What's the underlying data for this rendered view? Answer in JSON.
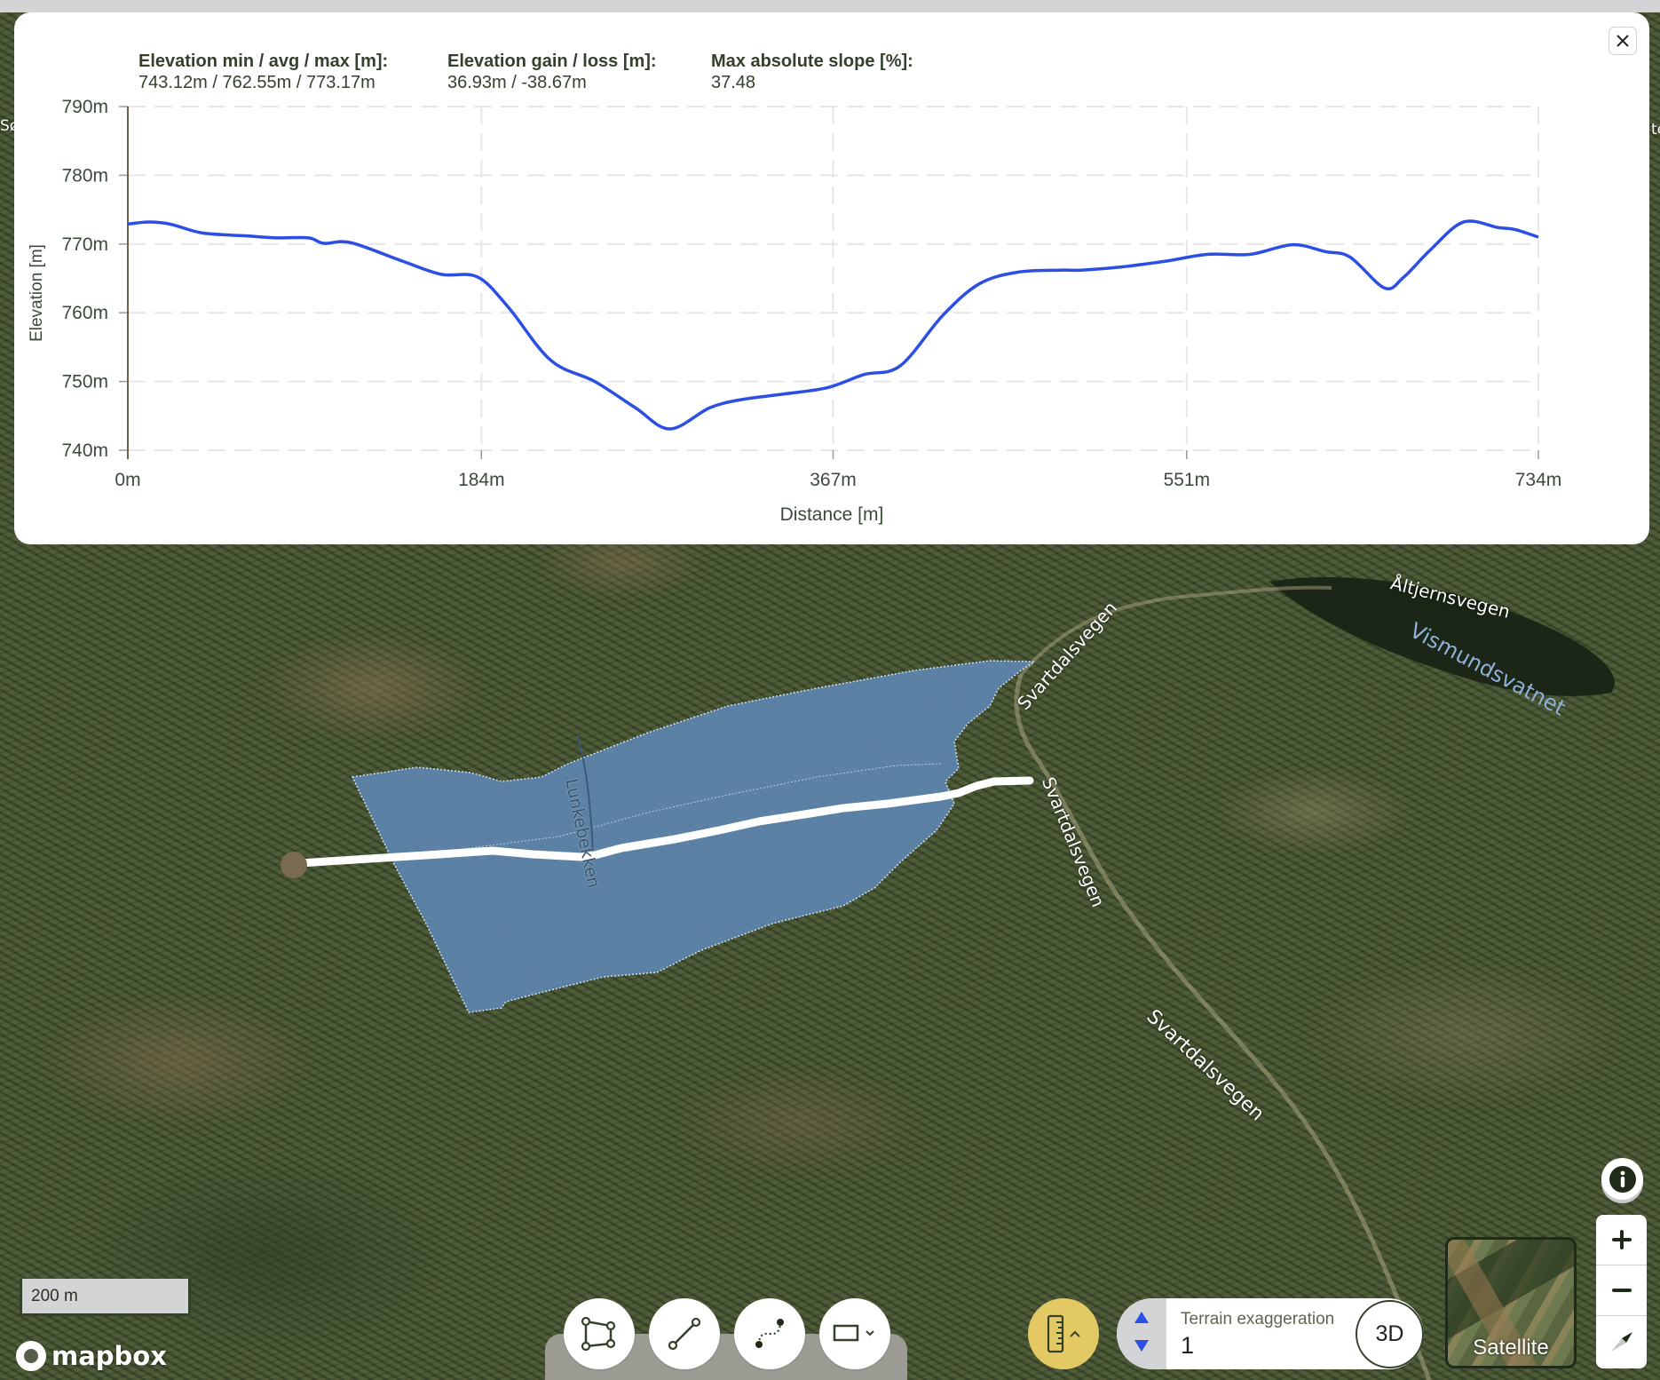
{
  "panel": {
    "stats": [
      {
        "heading": "Elevation min / avg / max [m]:",
        "value": "743.12m / 762.55m / 773.17m"
      },
      {
        "heading": "Elevation gain / loss [m]:",
        "value": "36.93m / -38.67m"
      },
      {
        "heading": "Max absolute slope [%]:",
        "value": "37.48"
      }
    ],
    "close_icon": "close-icon"
  },
  "chart_data": {
    "type": "line",
    "title": "",
    "xlabel": "Distance [m]",
    "ylabel": "Elevation [m]",
    "xlim": [
      0,
      734
    ],
    "ylim": [
      740,
      790
    ],
    "x_ticks": [
      0,
      184,
      367,
      551,
      734
    ],
    "x_tick_labels": [
      "0m",
      "184m",
      "367m",
      "551m",
      "734m"
    ],
    "y_ticks": [
      740,
      750,
      760,
      770,
      780,
      790
    ],
    "y_tick_labels": [
      "740m",
      "750m",
      "760m",
      "770m",
      "780m",
      "790m"
    ],
    "grid": true,
    "line_color": "#2b4ee4",
    "series": [
      {
        "name": "Elevation",
        "x": [
          0,
          11,
          22,
          39,
          61,
          77,
          94,
          102,
          116,
          143,
          163,
          182,
          198,
          220,
          243,
          264,
          282,
          303,
          320,
          342,
          364,
          383,
          402,
          424,
          443,
          463,
          485,
          496,
          518,
          540,
          562,
          584,
          606,
          623,
          636,
          654,
          664,
          678,
          695,
          713,
          722,
          734
        ],
        "y": [
          772.9,
          773.2,
          772.9,
          771.6,
          771.2,
          770.9,
          770.9,
          770.1,
          770.2,
          767.5,
          765.6,
          765.2,
          760.8,
          753.1,
          750.0,
          746.2,
          743.1,
          746.2,
          747.4,
          748.2,
          749.1,
          751.0,
          752.3,
          759.6,
          764.2,
          765.9,
          766.2,
          766.2,
          766.7,
          767.5,
          768.5,
          768.5,
          769.9,
          768.9,
          768.1,
          763.6,
          765.2,
          769.2,
          773.2,
          772.4,
          772.1,
          771.0
        ]
      }
    ]
  },
  "map": {
    "labels": {
      "altjernsvegen": "Åltjernsvegen",
      "lake": "Vismundsvatnet",
      "road_top": "Svartdalsvegen",
      "road_mid": "Svartdalsvegen",
      "road_low": "Svartdalsvegen",
      "stream": "Lunkebekken",
      "edge_left": "Sø",
      "edge_right": "te"
    },
    "polygon_color": "#5f88b5",
    "route_color": "#ffffff"
  },
  "controls": {
    "scale_bar": "200 m",
    "logo": "mapbox",
    "draw_tools": [
      {
        "name": "polygon-tool",
        "icon": "polygon-icon"
      },
      {
        "name": "line-tool",
        "icon": "line-icon"
      },
      {
        "name": "path-tool",
        "icon": "path-icon"
      },
      {
        "name": "rectangle-tool",
        "icon": "rectangle-icon"
      }
    ],
    "terrain": {
      "label": "Terrain exaggeration",
      "value": "1"
    },
    "btn_3d": "3D",
    "basemap": "Satellite"
  }
}
